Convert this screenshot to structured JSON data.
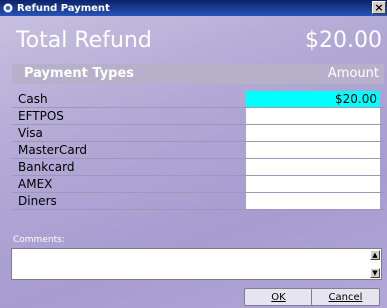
{
  "window": {
    "title": "Refund Payment",
    "close_label": "×"
  },
  "total": {
    "label": "Total Refund",
    "amount": "$20.00"
  },
  "table": {
    "header_type": "Payment Types",
    "header_amount": "Amount",
    "rows": [
      {
        "type": "Cash",
        "amount": "$20.00",
        "active": true
      },
      {
        "type": "EFTPOS",
        "amount": ""
      },
      {
        "type": "Visa",
        "amount": ""
      },
      {
        "type": "MasterCard",
        "amount": ""
      },
      {
        "type": "Bankcard",
        "amount": ""
      },
      {
        "type": "AMEX",
        "amount": ""
      },
      {
        "type": "Diners",
        "amount": ""
      }
    ]
  },
  "comments": {
    "label": "Comments:",
    "value": ""
  },
  "buttons": {
    "ok": "OK",
    "cancel": "Cancel"
  },
  "colors": {
    "titlebar": "#0a246a",
    "active_cell": "#00ffff",
    "window_bg": "#b3aad6"
  }
}
